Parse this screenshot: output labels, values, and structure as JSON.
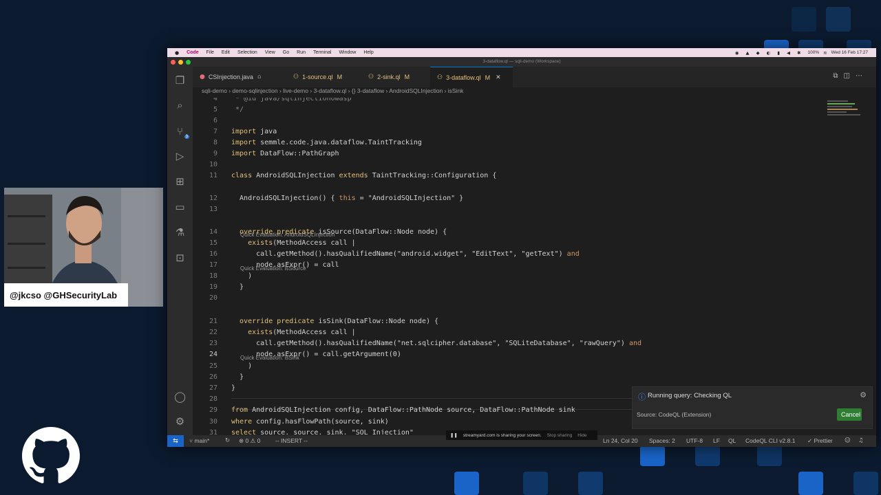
{
  "menubar": {
    "app": "Code",
    "items": [
      "File",
      "Edit",
      "Selection",
      "View",
      "Go",
      "Run",
      "Terminal",
      "Window",
      "Help"
    ],
    "clock": "Wed 16 Feb 17:27",
    "battery": "100%"
  },
  "window_title": "3-dataflow.ql — sqli-demo (Workspace)",
  "tabs": [
    {
      "label": "CSInjection.java",
      "marker": "",
      "icon": "error-icon"
    },
    {
      "label": "1-source.ql",
      "marker": "M"
    },
    {
      "label": "2-sink.ql",
      "marker": "M"
    },
    {
      "label": "3-dataflow.ql",
      "marker": "M",
      "active": true
    }
  ],
  "breadcrumb": [
    "sqli-demo",
    "demo-sqlinjection",
    "live-demo",
    "3-dataflow.ql",
    "{} 3-dataflow",
    "AndroidSQLInjection",
    "isSink"
  ],
  "scm_badge": "3",
  "code_lines": [
    {
      "n": "4",
      "t": " * @id java/sqlinjectionowasp"
    },
    {
      "n": "5",
      "t": " */"
    },
    {
      "n": "6",
      "t": ""
    },
    {
      "n": "7",
      "t": "import java"
    },
    {
      "n": "8",
      "t": "import semmle.code.java.dataflow.TaintTracking"
    },
    {
      "n": "9",
      "t": "import DataFlow::PathGraph"
    },
    {
      "n": "10",
      "t": ""
    },
    {
      "n": "11",
      "t": "class AndroidSQLInjection extends TaintTracking::Configuration {"
    },
    {
      "n": "12",
      "t": "  AndroidSQLInjection() { this = \"AndroidSQLInjection\" }"
    },
    {
      "n": "13",
      "t": ""
    },
    {
      "n": "14",
      "t": "  override predicate isSource(DataFlow::Node node) {"
    },
    {
      "n": "15",
      "t": "    exists(MethodAccess call |"
    },
    {
      "n": "16",
      "t": "      call.getMethod().hasQualifiedName(\"android.widget\", \"EditText\", \"getText\") and"
    },
    {
      "n": "17",
      "t": "      node.asExpr() = call"
    },
    {
      "n": "18",
      "t": "    )"
    },
    {
      "n": "19",
      "t": "  }"
    },
    {
      "n": "20",
      "t": ""
    },
    {
      "n": "21",
      "t": "  override predicate isSink(DataFlow::Node node) {"
    },
    {
      "n": "22",
      "t": "    exists(MethodAccess call |"
    },
    {
      "n": "23",
      "t": "      call.getMethod().hasQualifiedName(\"net.sqlcipher.database\", \"SQLiteDatabase\", \"rawQuery\") and"
    },
    {
      "n": "24",
      "t": "      node.asExpr() = call.getArgument(0)"
    },
    {
      "n": "25",
      "t": "    )"
    },
    {
      "n": "26",
      "t": "  }"
    },
    {
      "n": "27",
      "t": "}"
    },
    {
      "n": "28",
      "t": ""
    },
    {
      "n": "29",
      "t": "from AndroidSQLInjection config, DataFlow::PathNode source, DataFlow::PathNode sink"
    },
    {
      "n": "30",
      "t": "where config.hasFlowPath(source, sink)"
    },
    {
      "n": "31",
      "t": "select source, source, sink, \"SQL Injection\""
    }
  ],
  "code_lenses": {
    "l12": "Quick Evaluation: AndroidSQLInjection",
    "l14": "Quick Evaluation: isSource",
    "l21": "Quick Evaluation: isSink"
  },
  "notification": {
    "message": "Running query: Checking QL",
    "source": "Source: CodeQL (Extension)",
    "cancel": "Cancel"
  },
  "statusbar": {
    "branch": "main*",
    "errors": "0",
    "warnings": "0",
    "mode": "-- INSERT --",
    "position": "Ln 24, Col 20",
    "spaces": "Spaces: 2",
    "encoding": "UTF-8",
    "eol": "LF",
    "language": "QL",
    "codeql": "CodeQL CLI v2.8.1",
    "prettier": "Prettier"
  },
  "sharebar": {
    "text": "streamyard.com is sharing your screen.",
    "stop": "Stop sharing",
    "hide": "Hide"
  },
  "webcam": {
    "nametag": "@jkcso @GHSecurityLab"
  },
  "colors": {
    "keyword": "#e5c07b",
    "keyword_alt": "#d19a66",
    "editor_bg": "#1e1e1e",
    "cancel_bg": "#2e7d32",
    "background": "#0b1a2e"
  }
}
